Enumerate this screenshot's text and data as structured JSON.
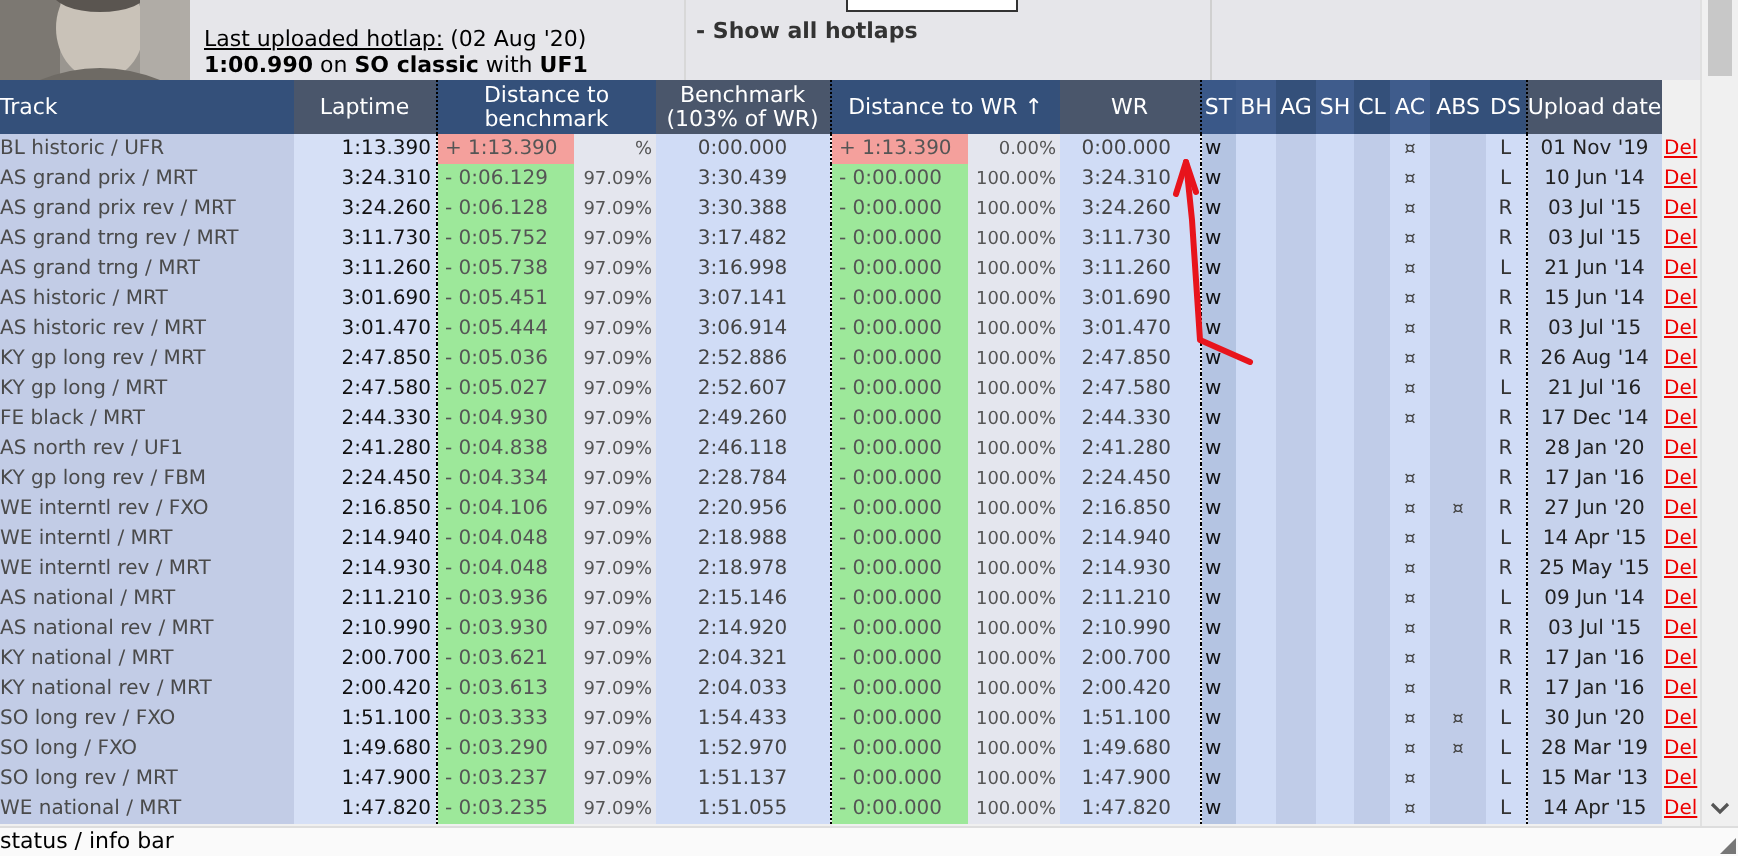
{
  "profile": {
    "last_upload_link": "Last uploaded hotlap:",
    "last_upload_date": "(02 Aug '20)",
    "last_upload_summary": "**1:00.990** on **SO classic** with **UF1**"
  },
  "show_all_link": "- Show all hotlaps",
  "table": {
    "columns": [
      {
        "label": "Track"
      },
      {
        "label": "Laptime"
      },
      {
        "label": "Distance to benchmark",
        "percent_column": true
      },
      {
        "label": "Benchmark (103% of WR)"
      },
      {
        "label": "Distance to WR ↑",
        "percent_column": true
      },
      {
        "label": "WR"
      },
      {
        "label": "ST"
      },
      {
        "label": "BH"
      },
      {
        "label": "AG"
      },
      {
        "label": "SH"
      },
      {
        "label": "CL"
      },
      {
        "label": "AC"
      },
      {
        "label": "ABS"
      },
      {
        "label": "DS"
      },
      {
        "label": "Upload date"
      }
    ],
    "rows": [
      {
        "track": "BL historic / UFR",
        "laptime": "1:13.390",
        "over": true,
        "dist_bench": "+ 1:13.390",
        "bench_pct": "%",
        "benchmark": "0:00.000",
        "dist_wr": "+ 1:13.390",
        "wr_pct": "0.00%",
        "wr": "0:00.000",
        "st": "w",
        "ac": "¤",
        "ds": "L",
        "date": "01 Nov '19",
        "action": "Del"
      },
      {
        "track": "AS grand prix / MRT",
        "laptime": "3:24.310",
        "over": false,
        "dist_bench": "- 0:06.129",
        "bench_pct": "97.09%",
        "benchmark": "3:30.439",
        "dist_wr": "- 0:00.000",
        "wr_pct": "100.00%",
        "wr": "3:24.310",
        "st": "w",
        "ac": "¤",
        "ds": "L",
        "date": "10 Jun '14",
        "action": "Del"
      },
      {
        "track": "AS grand prix rev / MRT",
        "laptime": "3:24.260",
        "over": false,
        "dist_bench": "- 0:06.128",
        "bench_pct": "97.09%",
        "benchmark": "3:30.388",
        "dist_wr": "- 0:00.000",
        "wr_pct": "100.00%",
        "wr": "3:24.260",
        "st": "w",
        "ac": "¤",
        "ds": "R",
        "date": "03 Jul '15",
        "action": "Del"
      },
      {
        "track": "AS grand trng rev / MRT",
        "laptime": "3:11.730",
        "over": false,
        "dist_bench": "- 0:05.752",
        "bench_pct": "97.09%",
        "benchmark": "3:17.482",
        "dist_wr": "- 0:00.000",
        "wr_pct": "100.00%",
        "wr": "3:11.730",
        "st": "w",
        "ac": "¤",
        "ds": "R",
        "date": "03 Jul '15",
        "action": "Del"
      },
      {
        "track": "AS grand trng / MRT",
        "laptime": "3:11.260",
        "over": false,
        "dist_bench": "- 0:05.738",
        "bench_pct": "97.09%",
        "benchmark": "3:16.998",
        "dist_wr": "- 0:00.000",
        "wr_pct": "100.00%",
        "wr": "3:11.260",
        "st": "w",
        "ac": "¤",
        "ds": "L",
        "date": "21 Jun '14",
        "action": "Del"
      },
      {
        "track": "AS historic / MRT",
        "laptime": "3:01.690",
        "over": false,
        "dist_bench": "- 0:05.451",
        "bench_pct": "97.09%",
        "benchmark": "3:07.141",
        "dist_wr": "- 0:00.000",
        "wr_pct": "100.00%",
        "wr": "3:01.690",
        "st": "w",
        "ac": "¤",
        "ds": "R",
        "date": "15 Jun '14",
        "action": "Del"
      },
      {
        "track": "AS historic rev / MRT",
        "laptime": "3:01.470",
        "over": false,
        "dist_bench": "- 0:05.444",
        "bench_pct": "97.09%",
        "benchmark": "3:06.914",
        "dist_wr": "- 0:00.000",
        "wr_pct": "100.00%",
        "wr": "3:01.470",
        "st": "w",
        "ac": "¤",
        "ds": "R",
        "date": "03 Jul '15",
        "action": "Del"
      },
      {
        "track": "KY gp long rev / MRT",
        "laptime": "2:47.850",
        "over": false,
        "dist_bench": "- 0:05.036",
        "bench_pct": "97.09%",
        "benchmark": "2:52.886",
        "dist_wr": "- 0:00.000",
        "wr_pct": "100.00%",
        "wr": "2:47.850",
        "st": "w",
        "ac": "¤",
        "ds": "R",
        "date": "26 Aug '14",
        "action": "Del"
      },
      {
        "track": "KY gp long / MRT",
        "laptime": "2:47.580",
        "over": false,
        "dist_bench": "- 0:05.027",
        "bench_pct": "97.09%",
        "benchmark": "2:52.607",
        "dist_wr": "- 0:00.000",
        "wr_pct": "100.00%",
        "wr": "2:47.580",
        "st": "w",
        "ac": "¤",
        "ds": "L",
        "date": "21 Jul '16",
        "action": "Del"
      },
      {
        "track": "FE black / MRT",
        "laptime": "2:44.330",
        "over": false,
        "dist_bench": "- 0:04.930",
        "bench_pct": "97.09%",
        "benchmark": "2:49.260",
        "dist_wr": "- 0:00.000",
        "wr_pct": "100.00%",
        "wr": "2:44.330",
        "st": "w",
        "ac": "¤",
        "ds": "R",
        "date": "17 Dec '14",
        "action": "Del"
      },
      {
        "track": "AS north rev / UF1",
        "laptime": "2:41.280",
        "over": false,
        "dist_bench": "- 0:04.838",
        "bench_pct": "97.09%",
        "benchmark": "2:46.118",
        "dist_wr": "- 0:00.000",
        "wr_pct": "100.00%",
        "wr": "2:41.280",
        "st": "w",
        "ds": "R",
        "date": "28 Jan '20",
        "action": "Del"
      },
      {
        "track": "KY gp long rev / FBM",
        "laptime": "2:24.450",
        "over": false,
        "dist_bench": "- 0:04.334",
        "bench_pct": "97.09%",
        "benchmark": "2:28.784",
        "dist_wr": "- 0:00.000",
        "wr_pct": "100.00%",
        "wr": "2:24.450",
        "st": "w",
        "ac": "¤",
        "ds": "R",
        "date": "17 Jan '16",
        "action": "Del"
      },
      {
        "track": "WE interntl rev / FXO",
        "laptime": "2:16.850",
        "over": false,
        "dist_bench": "- 0:04.106",
        "bench_pct": "97.09%",
        "benchmark": "2:20.956",
        "dist_wr": "- 0:00.000",
        "wr_pct": "100.00%",
        "wr": "2:16.850",
        "st": "w",
        "ac": "¤",
        "abs": "¤",
        "ds": "R",
        "date": "27 Jun '20",
        "action": "Del"
      },
      {
        "track": "WE interntl / MRT",
        "laptime": "2:14.940",
        "over": false,
        "dist_bench": "- 0:04.048",
        "bench_pct": "97.09%",
        "benchmark": "2:18.988",
        "dist_wr": "- 0:00.000",
        "wr_pct": "100.00%",
        "wr": "2:14.940",
        "st": "w",
        "ac": "¤",
        "ds": "L",
        "date": "14 Apr '15",
        "action": "Del"
      },
      {
        "track": "WE interntl rev / MRT",
        "laptime": "2:14.930",
        "over": false,
        "dist_bench": "- 0:04.048",
        "bench_pct": "97.09%",
        "benchmark": "2:18.978",
        "dist_wr": "- 0:00.000",
        "wr_pct": "100.00%",
        "wr": "2:14.930",
        "st": "w",
        "ac": "¤",
        "ds": "R",
        "date": "25 May '15",
        "action": "Del"
      },
      {
        "track": "AS national / MRT",
        "laptime": "2:11.210",
        "over": false,
        "dist_bench": "- 0:03.936",
        "bench_pct": "97.09%",
        "benchmark": "2:15.146",
        "dist_wr": "- 0:00.000",
        "wr_pct": "100.00%",
        "wr": "2:11.210",
        "st": "w",
        "ac": "¤",
        "ds": "L",
        "date": "09 Jun '14",
        "action": "Del"
      },
      {
        "track": "AS national rev / MRT",
        "laptime": "2:10.990",
        "over": false,
        "dist_bench": "- 0:03.930",
        "bench_pct": "97.09%",
        "benchmark": "2:14.920",
        "dist_wr": "- 0:00.000",
        "wr_pct": "100.00%",
        "wr": "2:10.990",
        "st": "w",
        "ac": "¤",
        "ds": "R",
        "date": "03 Jul '15",
        "action": "Del"
      },
      {
        "track": "KY national / MRT",
        "laptime": "2:00.700",
        "over": false,
        "dist_bench": "- 0:03.621",
        "bench_pct": "97.09%",
        "benchmark": "2:04.321",
        "dist_wr": "- 0:00.000",
        "wr_pct": "100.00%",
        "wr": "2:00.700",
        "st": "w",
        "ac": "¤",
        "ds": "R",
        "date": "17 Jan '16",
        "action": "Del"
      },
      {
        "track": "KY national rev / MRT",
        "laptime": "2:00.420",
        "over": false,
        "dist_bench": "- 0:03.613",
        "bench_pct": "97.09%",
        "benchmark": "2:04.033",
        "dist_wr": "- 0:00.000",
        "wr_pct": "100.00%",
        "wr": "2:00.420",
        "st": "w",
        "ac": "¤",
        "ds": "R",
        "date": "17 Jan '16",
        "action": "Del"
      },
      {
        "track": "SO long rev / FXO",
        "laptime": "1:51.100",
        "over": false,
        "dist_bench": "- 0:03.333",
        "bench_pct": "97.09%",
        "benchmark": "1:54.433",
        "dist_wr": "- 0:00.000",
        "wr_pct": "100.00%",
        "wr": "1:51.100",
        "st": "w",
        "ac": "¤",
        "abs": "¤",
        "ds": "L",
        "date": "30 Jun '20",
        "action": "Del"
      },
      {
        "track": "SO long / FXO",
        "laptime": "1:49.680",
        "over": false,
        "dist_bench": "- 0:03.290",
        "bench_pct": "97.09%",
        "benchmark": "1:52.970",
        "dist_wr": "- 0:00.000",
        "wr_pct": "100.00%",
        "wr": "1:49.680",
        "st": "w",
        "ac": "¤",
        "abs": "¤",
        "ds": "L",
        "date": "28 Mar '19",
        "action": "Del"
      },
      {
        "track": "SO long rev / MRT",
        "laptime": "1:47.900",
        "over": false,
        "dist_bench": "- 0:03.237",
        "bench_pct": "97.09%",
        "benchmark": "1:51.137",
        "dist_wr": "- 0:00.000",
        "wr_pct": "100.00%",
        "wr": "1:47.900",
        "st": "w",
        "ac": "¤",
        "ds": "L",
        "date": "15 Mar '13",
        "action": "Del"
      },
      {
        "track": "WE national / MRT",
        "laptime": "1:47.820",
        "over": false,
        "dist_bench": "- 0:03.235",
        "bench_pct": "97.09%",
        "benchmark": "1:51.055",
        "dist_wr": "- 0:00.000",
        "wr_pct": "100.00%",
        "wr": "1:47.820",
        "st": "w",
        "ac": "¤",
        "ds": "L",
        "date": "14 Apr '15",
        "action": "Del"
      }
    ]
  },
  "status_bar": "status / info bar"
}
